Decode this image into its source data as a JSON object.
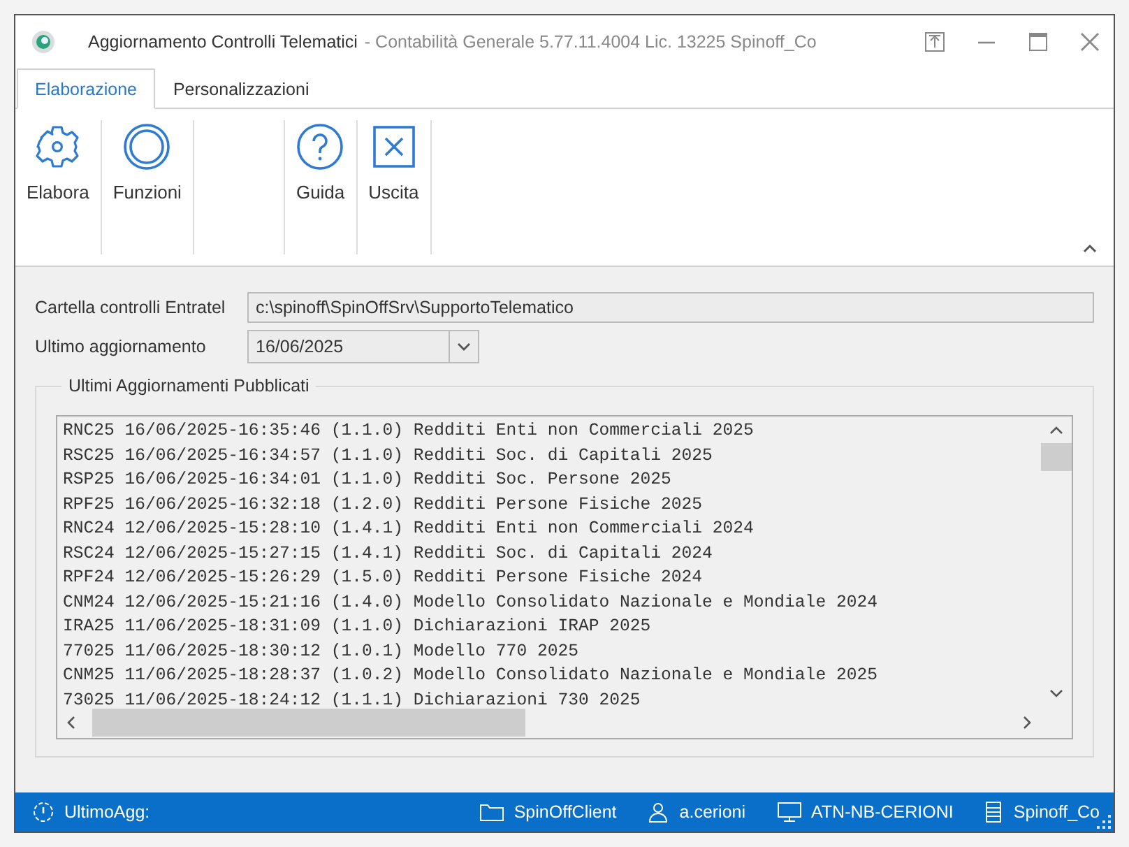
{
  "window": {
    "title": "Aggiornamento Controlli Telematici",
    "subtitle": "- Contabilità Generale 5.77.11.4004 Lic. 13225 Spinoff_Co"
  },
  "tabs": [
    {
      "label": "Elaborazione",
      "selected": true
    },
    {
      "label": "Personalizzazioni",
      "selected": false
    }
  ],
  "ribbon": [
    {
      "label": "Elabora",
      "kind": "gear"
    },
    {
      "label": "Funzioni",
      "kind": "ring"
    },
    {
      "kind": "empty"
    },
    {
      "label": "Guida",
      "kind": "help"
    },
    {
      "label": "Uscita",
      "kind": "exit"
    }
  ],
  "form": {
    "folder_label": "Cartella controlli Entratel",
    "folder_value": "c:\\spinoff\\SpinOffSrv\\SupportoTelematico",
    "update_label": "Ultimo aggiornamento",
    "update_value": "16/06/2025"
  },
  "group": {
    "title": "Ultimi Aggiornamenti Pubblicati",
    "rows": [
      "RNC25 16/06/2025-16:35:46 (1.1.0) Redditi Enti non Commerciali 2025",
      "RSC25 16/06/2025-16:34:57 (1.1.0) Redditi Soc. di Capitali 2025",
      "RSP25 16/06/2025-16:34:01 (1.1.0) Redditi Soc. Persone 2025",
      "RPF25 16/06/2025-16:32:18 (1.2.0) Redditi Persone Fisiche 2025",
      "RNC24 12/06/2025-15:28:10 (1.4.1) Redditi Enti non Commerciali 2024",
      "RSC24 12/06/2025-15:27:15 (1.4.1) Redditi Soc. di Capitali 2024",
      "RPF24 12/06/2025-15:26:29 (1.5.0) Redditi Persone Fisiche 2024",
      "CNM24 12/06/2025-15:21:16 (1.4.0) Modello Consolidato Nazionale e Mondiale 2024",
      "IRA25 11/06/2025-18:31:09 (1.1.0) Dichiarazioni IRAP 2025",
      "77025 11/06/2025-18:30:12 (1.0.1) Modello 770 2025",
      "CNM25 11/06/2025-18:28:37 (1.0.2) Modello Consolidato Nazionale e Mondiale 2025",
      "73025 11/06/2025-18:24:12 (1.1.1) Dichiarazioni 730 2025"
    ]
  },
  "status_bar": [
    {
      "label": "UltimoAgg:",
      "kind": "clock"
    },
    {
      "label": "SpinOffClient",
      "kind": "folder"
    },
    {
      "label": "a.cerioni",
      "kind": "user"
    },
    {
      "label": "ATN-NB-CERIONI",
      "kind": "monitor"
    },
    {
      "label": "Spinoff_Co",
      "kind": "server"
    }
  ]
}
